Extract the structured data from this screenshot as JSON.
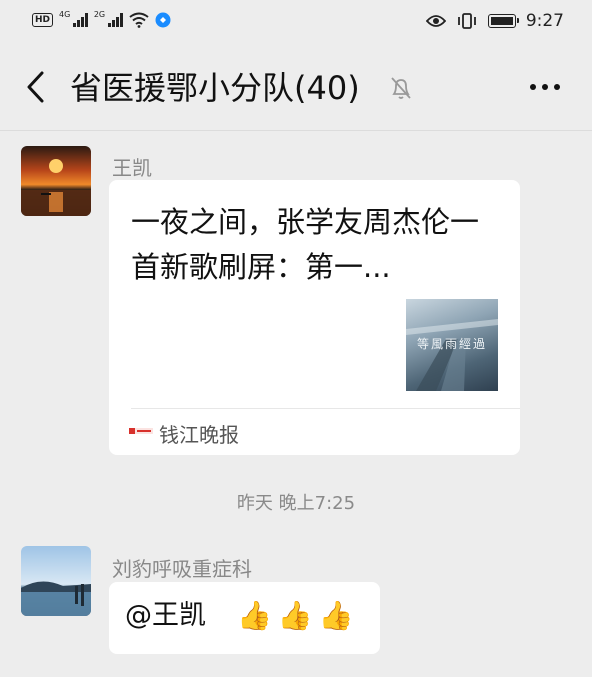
{
  "status_bar": {
    "hd_label": "HD",
    "net1": "4G",
    "net2": "2G",
    "time": "9:27"
  },
  "header": {
    "title": "省医援鄂小分队(40)",
    "icons": [
      "back-arrow-icon",
      "mute-bell-icon",
      "more-icon"
    ]
  },
  "messages": [
    {
      "sender": "王凯",
      "type": "article",
      "article_title": "一夜之间，张学友周杰伦一首新歌刷屏：第一...",
      "thumbnail_text": "等風雨經過",
      "source_logo_text": "钱江晚报",
      "source_name": "钱江晚报"
    },
    {
      "type": "timestamp",
      "text": "昨天 晚上7:25"
    },
    {
      "sender": "刘豹呼吸重症科",
      "type": "text",
      "text": "@王凯",
      "emoji": [
        "👍",
        "👍",
        "👍"
      ]
    }
  ]
}
